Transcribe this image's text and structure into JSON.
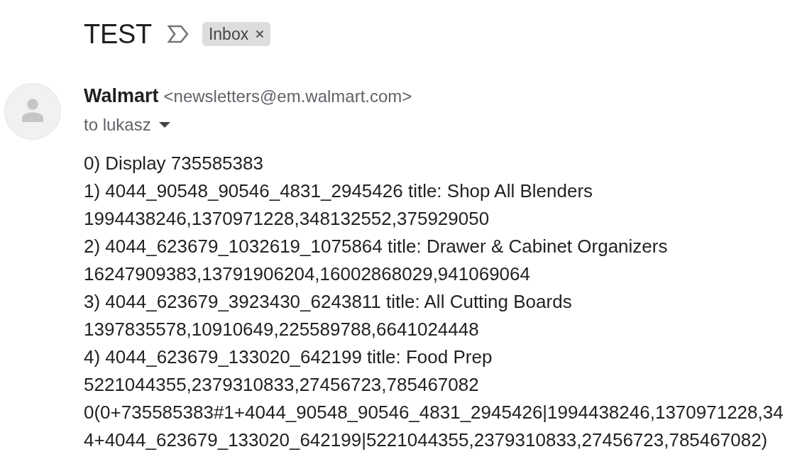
{
  "subject": {
    "title": "TEST",
    "labels": [
      {
        "text": "Inbox"
      }
    ]
  },
  "message": {
    "sender_name": "Walmart",
    "sender_email": "<newsletters@em.walmart.com>",
    "recipient": "to lukasz",
    "body_lines": [
      "0) Display 735585383",
      "1) 4044_90548_90546_4831_2945426 title: Shop All Blenders",
      "1994438246,1370971228,348132552,375929050",
      "2) 4044_623679_1032619_1075864 title: Drawer & Cabinet Organizers",
      "16247909383,13791906204,16002868029,941069064",
      "3) 4044_623679_3923430_6243811 title: All Cutting Boards",
      "1397835578,10910649,225589788,6641024448",
      "4) 4044_623679_133020_642199 title: Food Prep",
      "5221044355,2379310833,27456723,785467082",
      "0(0+735585383#1+4044_90548_90546_4831_2945426|1994438246,1370971228,34",
      "4+4044_623679_133020_642199|5221044355,2379310833,27456723,785467082)"
    ]
  }
}
